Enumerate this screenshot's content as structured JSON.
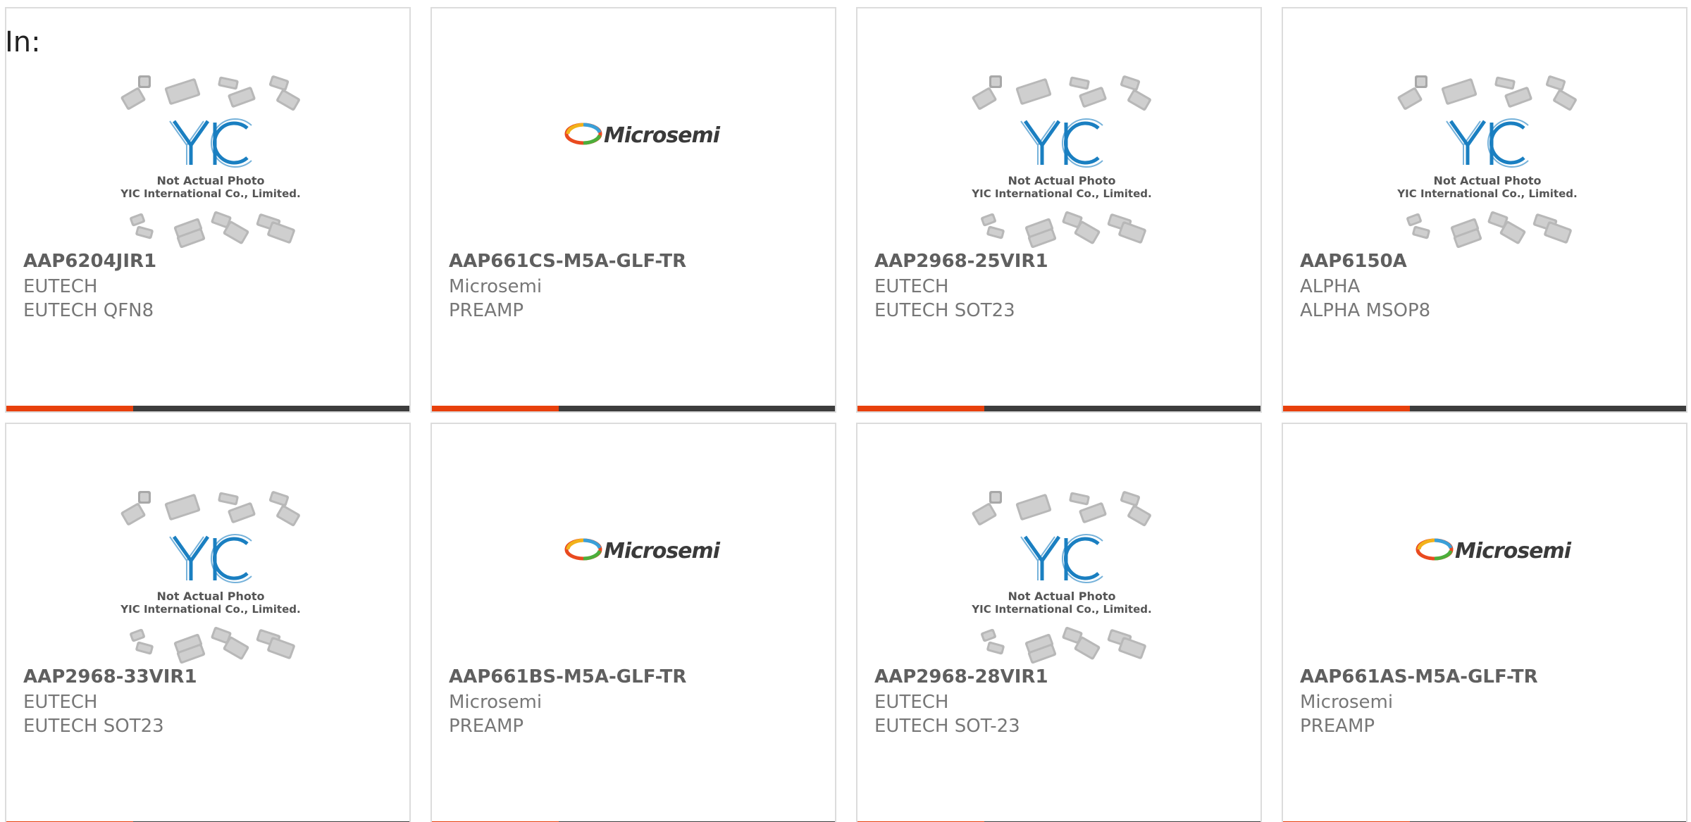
{
  "header": {
    "label": "In:"
  },
  "colors": {
    "accent": "#e8400c",
    "bar": "#3d3d3d",
    "yic_blue": "#1a7fc1"
  },
  "cards": [
    {
      "part": "AAP6204JIR1",
      "mfr": "EUTECH",
      "desc": "EUTECH QFN8",
      "image": "yic-placeholder",
      "caption1": "Not Actual Photo",
      "caption2": "YIC International Co., Limited."
    },
    {
      "part": "AAP661CS-M5A-GLF-TR",
      "mfr": "Microsemi",
      "desc": "PREAMP",
      "image": "microsemi-logo",
      "logo_text": "Microsemi"
    },
    {
      "part": "AAP2968-25VIR1",
      "mfr": "EUTECH",
      "desc": "EUTECH SOT23",
      "image": "yic-placeholder",
      "caption1": "Not Actual Photo",
      "caption2": "YIC International Co., Limited."
    },
    {
      "part": "AAP6150A",
      "mfr": "ALPHA",
      "desc": "ALPHA MSOP8",
      "image": "yic-placeholder",
      "caption1": "Not Actual Photo",
      "caption2": "YIC International Co., Limited."
    },
    {
      "part": "AAP2968-33VIR1",
      "mfr": "EUTECH",
      "desc": "EUTECH SOT23",
      "image": "yic-placeholder",
      "caption1": "Not Actual Photo",
      "caption2": "YIC International Co., Limited."
    },
    {
      "part": "AAP661BS-M5A-GLF-TR",
      "mfr": "Microsemi",
      "desc": "PREAMP",
      "image": "microsemi-logo",
      "logo_text": "Microsemi"
    },
    {
      "part": "AAP2968-28VIR1",
      "mfr": "EUTECH",
      "desc": "EUTECH SOT-23",
      "image": "yic-placeholder",
      "caption1": "Not Actual Photo",
      "caption2": "YIC International Co., Limited."
    },
    {
      "part": "AAP661AS-M5A-GLF-TR",
      "mfr": "Microsemi",
      "desc": "PREAMP",
      "image": "microsemi-logo",
      "logo_text": "Microsemi"
    }
  ]
}
